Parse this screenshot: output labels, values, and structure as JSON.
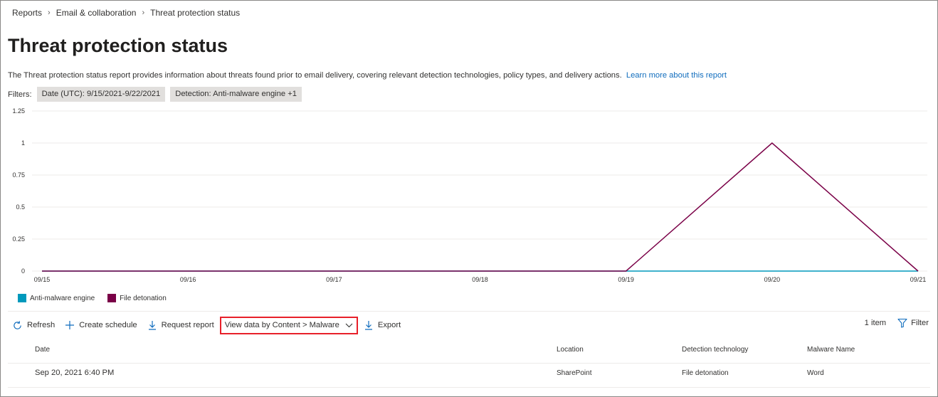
{
  "breadcrumb": [
    "Reports",
    "Email & collaboration",
    "Threat protection status"
  ],
  "page": {
    "title": "Threat protection status",
    "description": "The Threat protection status report provides information about threats found prior to email delivery, covering relevant detection technologies, policy types, and delivery actions.",
    "learn_more": "Learn more about this report"
  },
  "filters": {
    "label": "Filters:",
    "date_key": "Date (UTC): ",
    "date_value": "9/15/2021-9/22/2021",
    "detection_key": "Detection: ",
    "detection_value": "Anti-malware engine +1"
  },
  "chart_data": {
    "type": "line",
    "x": [
      "09/15",
      "09/16",
      "09/17",
      "09/18",
      "09/19",
      "09/20",
      "09/21"
    ],
    "y_ticks": [
      "1.25",
      "1",
      "0.75",
      "0.5",
      "0.25",
      "0"
    ],
    "ylim": [
      0,
      1.25
    ],
    "grid": true,
    "legend_position": "bottom-left",
    "series": [
      {
        "name": "Anti-malware engine",
        "color": "#0099bc",
        "values": [
          0,
          0,
          0,
          0,
          0,
          0,
          0
        ]
      },
      {
        "name": "File detonation",
        "color": "#7a0047",
        "values": [
          0,
          0,
          0,
          0,
          0,
          1,
          0
        ]
      }
    ]
  },
  "toolbar": {
    "refresh": "Refresh",
    "create_schedule": "Create schedule",
    "request_report": "Request report",
    "view_data": "View data by Content > Malware",
    "export": "Export",
    "item_count": "1 item",
    "filter": "Filter"
  },
  "table": {
    "columns": [
      "Date",
      "Location",
      "Detection technology",
      "Malware Name"
    ],
    "rows": [
      {
        "date": "Sep 20, 2021 6:40 PM",
        "location": "SharePoint",
        "detection": "File detonation",
        "malware": "Word"
      }
    ]
  },
  "colors": {
    "accent": "#0f6cbd",
    "highlight_border": "#e8202a"
  }
}
